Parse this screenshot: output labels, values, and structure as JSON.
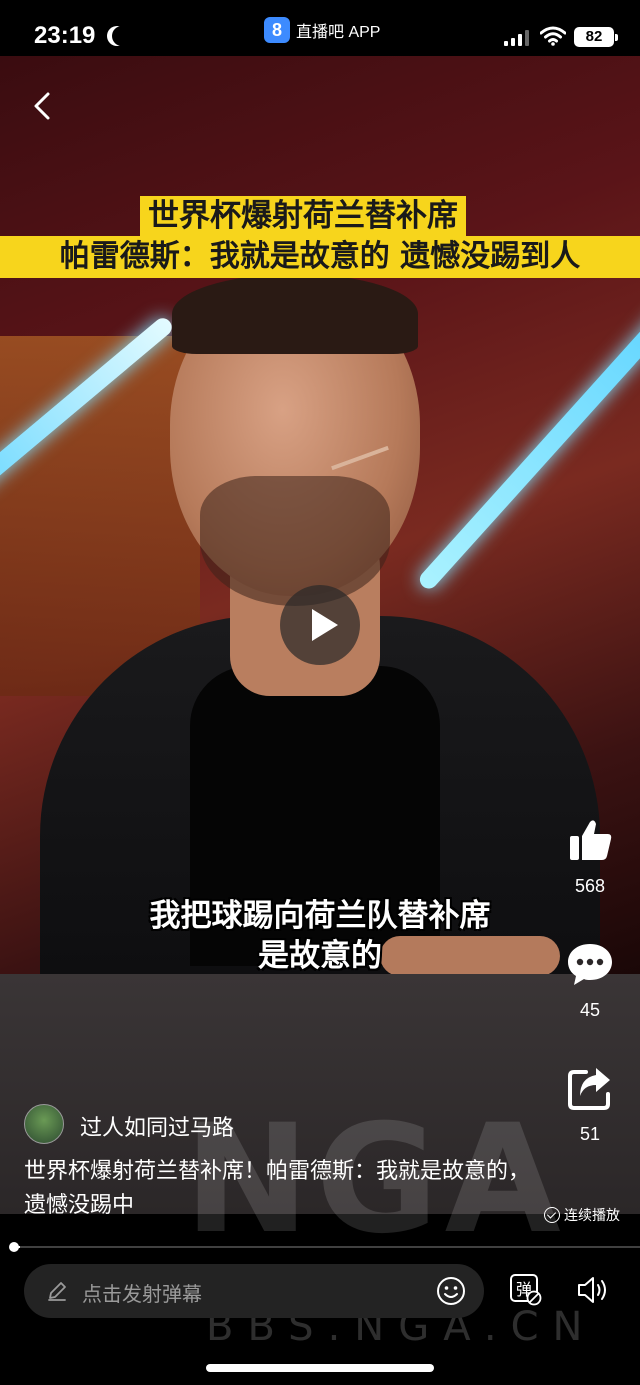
{
  "status_bar": {
    "time": "23:19",
    "app_label": "直播吧 APP",
    "app_logo_text": "8",
    "battery": "82",
    "icons": [
      "moon-icon",
      "signal-icon",
      "wifi-icon",
      "battery-icon"
    ]
  },
  "video": {
    "headline_line1": "世界杯爆射荷兰替补席",
    "headline_line2": "帕雷德斯：我就是故意的 遗憾没踢到人",
    "subtitle_line1": "我把球踢向荷兰队替补席",
    "subtitle_line2": "是故意的",
    "state": "paused",
    "progress": 0.01,
    "accent_color": "#f7d51c"
  },
  "actions": {
    "likes": "568",
    "comments": "45",
    "shares": "51"
  },
  "post": {
    "author": "过人如同过马路",
    "description": "世界杯爆射荷兰替补席！帕雷德斯：我就是故意的，遗憾没踢中",
    "autoplay_label": "连续播放"
  },
  "input": {
    "placeholder": "点击发射弹幕",
    "danmaku_toggle": "弹"
  },
  "watermark": {
    "logo": "NGA",
    "site": "BBS.NGA.CN"
  }
}
